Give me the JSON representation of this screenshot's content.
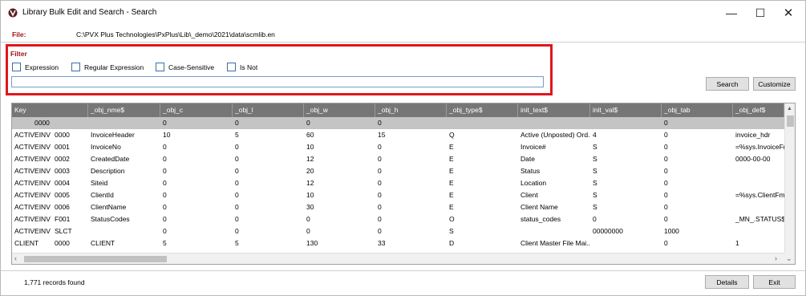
{
  "window": {
    "title": "Library Bulk Edit and Search - Search",
    "minimize": "—",
    "maximize": "☐",
    "close": "✕"
  },
  "file": {
    "label": "File:",
    "path": "C:\\PVX Plus Technologies\\PxPlus\\Lib\\_demo\\2021\\data\\scmlib.en"
  },
  "filter": {
    "title": "Filter",
    "options": [
      "Expression",
      "Regular Expression",
      "Case-Sensitive",
      "Is Not"
    ],
    "value": ""
  },
  "buttons": {
    "search": "Search",
    "customize": "Customize",
    "details": "Details",
    "exit": "Exit"
  },
  "grid": {
    "columns": [
      "Key",
      "_obj_nme$",
      "_obj_c",
      "_obj_l",
      "_obj_w",
      "_obj_h",
      "_obj_type$",
      "init_text$",
      "init_val$",
      "_obj_tab",
      "_obj_def$"
    ],
    "rows": [
      {
        "key1": "",
        "key2": "0000",
        "cells": [
          "",
          "0",
          "0",
          "0",
          "0",
          "",
          "",
          "",
          "0",
          ""
        ]
      },
      {
        "key1": "ACTIVEINV",
        "key2": "0000",
        "cells": [
          "InvoiceHeader",
          "10",
          "5",
          "60",
          "15",
          "Q",
          "Active (Unposted) Ord...",
          "4",
          "0",
          "invoice_hdr"
        ]
      },
      {
        "key1": "ACTIVEINV",
        "key2": "0001",
        "cells": [
          "InvoiceNo",
          "0",
          "0",
          "10",
          "0",
          "E",
          "Invoice#",
          "S",
          "0",
          "=%sys.InvoiceFmt"
        ]
      },
      {
        "key1": "ACTIVEINV",
        "key2": "0002",
        "cells": [
          "CreatedDate",
          "0",
          "0",
          "12",
          "0",
          "E",
          "Date",
          "S",
          "0",
          "0000-00-00"
        ]
      },
      {
        "key1": "ACTIVEINV",
        "key2": "0003",
        "cells": [
          "Description",
          "0",
          "0",
          "20",
          "0",
          "E",
          "Status",
          "S",
          "0",
          ""
        ]
      },
      {
        "key1": "ACTIVEINV",
        "key2": "0004",
        "cells": [
          "Siteid",
          "0",
          "0",
          "12",
          "0",
          "E",
          "Location",
          "S",
          "0",
          ""
        ]
      },
      {
        "key1": "ACTIVEINV",
        "key2": "0005",
        "cells": [
          "ClientId",
          "0",
          "0",
          "10",
          "0",
          "E",
          "Client",
          "S",
          "0",
          "=%sys.ClientFmt$"
        ]
      },
      {
        "key1": "ACTIVEINV",
        "key2": "0006",
        "cells": [
          "ClientName",
          "0",
          "0",
          "30",
          "0",
          "E",
          "Client Name",
          "S",
          "0",
          ""
        ]
      },
      {
        "key1": "ACTIVEINV",
        "key2": "F001",
        "cells": [
          "StatusCodes",
          "0",
          "0",
          "0",
          "0",
          "O",
          "status_codes",
          "0",
          "0",
          "_MN_.STATUS$"
        ]
      },
      {
        "key1": "ACTIVEINV",
        "key2": "SLCT",
        "cells": [
          "",
          "0",
          "0",
          "0",
          "0",
          "S",
          "",
          "00000000",
          "1000",
          ""
        ]
      },
      {
        "key1": "CLIENT",
        "key2": "0000",
        "cells": [
          "CLIENT",
          "5",
          "5",
          "130",
          "33",
          "D",
          "Client Master File Mai...",
          "",
          "0",
          "1"
        ]
      }
    ]
  },
  "status": {
    "records": "1,771 records found"
  },
  "colors": {
    "label_red": "#9b1515",
    "highlight_box": "#e0161d",
    "header_bg": "#767676",
    "selected_row": "#c4c4c4"
  },
  "icons": {
    "app": "library-app-icon",
    "scroll_up": "up-arrow-icon",
    "scroll_down": "down-arrow-icon",
    "scroll_left": "left-arrow-icon",
    "scroll_right": "right-arrow-icon"
  }
}
